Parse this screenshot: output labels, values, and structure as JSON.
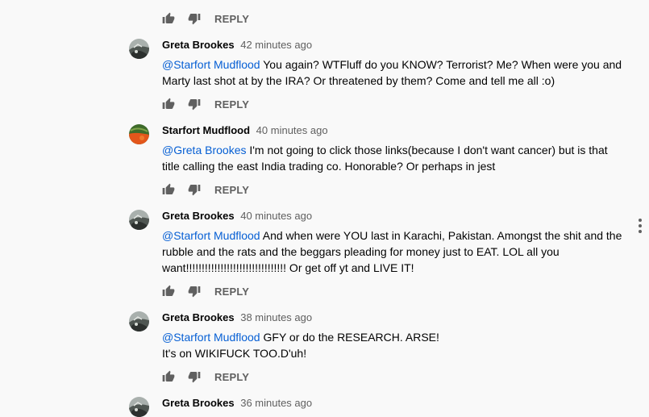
{
  "actions": {
    "reply_label": "REPLY"
  },
  "comments": [
    {
      "author": "Greta Brookes",
      "time": "42 minutes ago",
      "mention": "@Starfort Mudflood",
      "lines": [
        " You again? WTFluff do you KNOW? Terrorist? Me? When were you and",
        "Marty last shot at by the IRA? Or threatened by them? Come and tell me all :o)"
      ]
    },
    {
      "author": "Starfort Mudflood",
      "time": "40 minutes ago",
      "mention": "@Greta Brookes",
      "lines": [
        " I'm not going to click those links(because I don't want cancer) but is that",
        "title calling the east India trading co. Honorable? Or perhaps in jest"
      ]
    },
    {
      "author": "Greta Brookes",
      "time": "40 minutes ago",
      "mention": "@Starfort Mudflood",
      "lines": [
        " And when were YOU last in Karachi, Pakistan. Amongst the shit and the",
        "rubble and the rats and the beggars pleading for money just to EAT. LOL all you",
        "want!!!!!!!!!!!!!!!!!!!!!!!!!!!!!!!! Or get off yt and LIVE IT!"
      ]
    },
    {
      "author": "Greta Brookes",
      "time": "38 minutes ago",
      "mention": "@Starfort Mudflood",
      "lines": [
        " GFY or do the RESEARCH. ARSE!",
        "It's on WIKIFUCK TOO.D'uh!"
      ]
    },
    {
      "author": "Greta Brookes",
      "time": "36 minutes ago"
    }
  ],
  "icons": {
    "like": "thumb-up-icon",
    "dislike": "thumb-down-icon",
    "menu": "more-vert-icon",
    "avatar_greta": "cat-avatar",
    "avatar_starfort": "green-orange-avatar"
  }
}
